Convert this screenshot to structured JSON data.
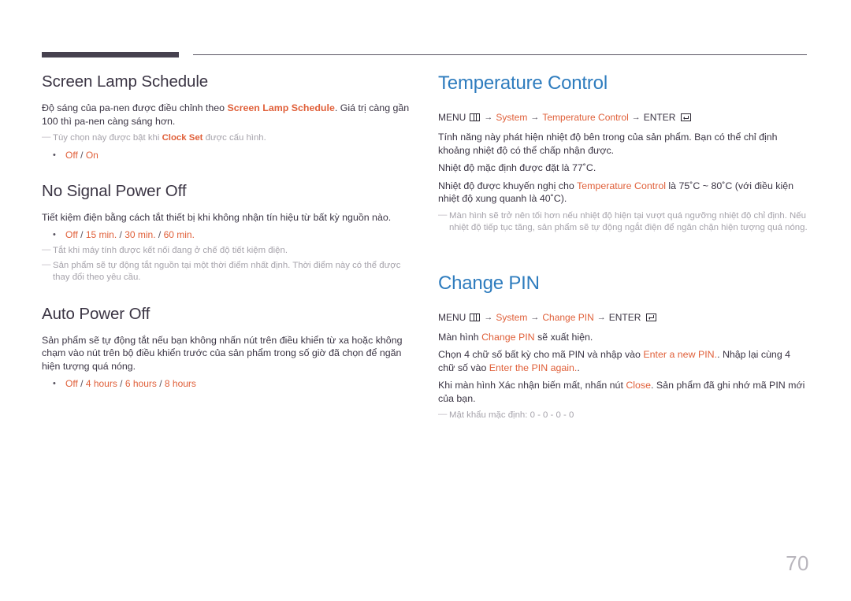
{
  "page": {
    "number": "70"
  },
  "icons": {
    "menu": "menu-bars-icon",
    "enter": "enter-return-icon",
    "arrow": "→"
  },
  "colors": {
    "accent_red": "#e0603a",
    "heading_blue": "#2e7cbe",
    "heading_dark": "#3b3544",
    "note_gray": "#a6a3ab",
    "rule_dark": "#46414f",
    "page_number_gray": "#b9b6bd"
  },
  "left_column": {
    "sections": [
      {
        "heading": "Screen Lamp Schedule",
        "body_1_pre": "Độ sáng của pa-nen được điều chỉnh theo ",
        "body_1_accent": "Screen Lamp Schedule",
        "body_1_post": ". Giá trị càng gần 100 thì pa-nen càng sáng hơn.",
        "note_pre": "Tùy chọn này được bật khi ",
        "note_accent": "Clock Set",
        "note_post": " được cấu hình.",
        "option_1": "Off",
        "option_sep": " / ",
        "option_2": "On"
      },
      {
        "heading": "No Signal Power Off",
        "body_1": "Tiết kiệm điện bằng cách tắt thiết bị khi không nhận tín hiệu từ bất kỳ nguồn nào.",
        "option_1": "Off",
        "option_2": "15 min.",
        "option_3": "30 min.",
        "option_4": "60 min.",
        "note_1": "Tắt khi máy tính được kết nối đang ở chế độ tiết kiệm điện.",
        "note_2": "Sản phẩm sẽ tự động tắt nguồn tại một thời điểm nhất định. Thời điểm này có thể được thay đổi theo yêu cầu."
      },
      {
        "heading": "Auto Power Off",
        "body_1": "Sản phẩm sẽ tự động tắt nếu bạn không nhấn nút trên điều khiển từ xa hoặc không chạm vào nút trên bộ điều khiển trước của sản phẩm trong số giờ đã chọn để ngăn hiện tượng quá nóng.",
        "option_1": "Off",
        "option_2": "4 hours",
        "option_3": "6 hours",
        "option_4": "8 hours"
      }
    ]
  },
  "right_column": {
    "sections": [
      {
        "heading": "Temperature Control",
        "menu_path": {
          "menu_label": "MENU",
          "item_1": "System",
          "item_2": "Temperature Control",
          "enter_label": "ENTER"
        },
        "body_1": "Tính năng này phát hiện nhiệt độ bên trong của sản phẩm. Bạn có thể chỉ định khoảng nhiệt độ có thể chấp nhận được.",
        "body_2": "Nhiệt độ mặc định được đặt là 77˚C.",
        "body_3_pre": "Nhiệt độ được khuyến nghị cho ",
        "body_3_accent": "Temperature Control",
        "body_3_post": " là 75˚C ~ 80˚C (với điều kiện nhiệt độ xung quanh là 40˚C).",
        "note_1": "Màn hình sẽ trở nên tối hơn nếu nhiệt độ hiện tại vượt quá ngưỡng nhiệt độ chỉ định. Nếu nhiệt độ tiếp tục tăng, sản phẩm sẽ tự động ngắt điện để ngăn chặn hiện tượng quá nóng."
      },
      {
        "heading": "Change PIN",
        "menu_path": {
          "menu_label": "MENU",
          "item_1": "System",
          "item_2": "Change PIN",
          "enter_label": "ENTER"
        },
        "body_1_pre": "Màn hình ",
        "body_1_accent": "Change PIN",
        "body_1_post": " sẽ xuất hiện.",
        "body_2_pre": "Chọn 4 chữ số bất kỳ cho mã PIN và nhập vào ",
        "body_2_accent_1": "Enter a new PIN.",
        "body_2_mid": ". Nhập lại cùng 4 chữ số vào ",
        "body_2_accent_2": "Enter the PIN again.",
        "body_2_post": ".",
        "body_3_pre": "Khi màn hình Xác nhận biến mất, nhấn nút ",
        "body_3_accent": "Close",
        "body_3_post": ". Sản phẩm đã ghi nhớ mã PIN mới của bạn.",
        "note_1": "Mật khẩu mặc định: 0 - 0 - 0 - 0"
      }
    ]
  }
}
